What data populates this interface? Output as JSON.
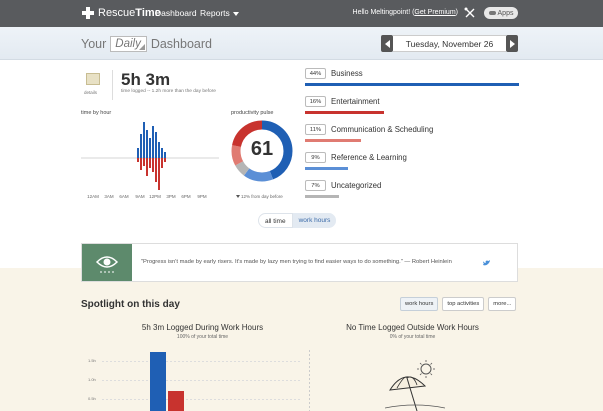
{
  "nav": {
    "logo_light": "Rescue",
    "logo_bold": "Time",
    "dashboard": "Dashboard",
    "reports": "Reports",
    "hello_prefix": "Hello Meltingpoint! (",
    "premium_link": "Get Premium",
    "hello_suffix": ")",
    "apps": "Apps"
  },
  "header": {
    "your": "Your",
    "period": "Daily",
    "dashboard": "Dashboard",
    "date": "Tuesday, November 26"
  },
  "summary": {
    "details_label": "details",
    "total_time": "5h 3m",
    "note": "time logged -- 1.2h more than the day before"
  },
  "hourly": {
    "label": "time by hour",
    "hours": [
      "12AM",
      "3AM",
      "6AM",
      "9AM",
      "12PM",
      "3PM",
      "6PM",
      "9PM"
    ]
  },
  "pulse": {
    "label": "productivity pulse",
    "value": "61",
    "note": "12% from day before"
  },
  "toggle": {
    "all_time": "all time",
    "work_hours": "work hours"
  },
  "categories": [
    {
      "pct": "44%",
      "name": "Business",
      "fraction": 1.0,
      "color": "#1f5fb4"
    },
    {
      "pct": "16%",
      "name": "Entertainment",
      "fraction": 0.37,
      "color": "#c8332e"
    },
    {
      "pct": "11%",
      "name": "Communication & Scheduling",
      "fraction": 0.26,
      "color": "#e07b72"
    },
    {
      "pct": "9%",
      "name": "Reference & Learning",
      "fraction": 0.2,
      "color": "#5b8fd6"
    },
    {
      "pct": "7%",
      "name": "Uncategorized",
      "fraction": 0.16,
      "color": "#b5b5b5"
    }
  ],
  "quote": {
    "text": "\"Progress isn't made by early risers. It's made by lazy men trying to find easier ways to do something.\" — Robert Heinlein"
  },
  "spotlight": {
    "title": "Spotlight on this day",
    "tabs": [
      "work hours",
      "top activities",
      "more..."
    ],
    "left_title": "5h 3m Logged During Work Hours",
    "left_sub": "100% of your total time",
    "right_title": "No Time Logged Outside Work Hours",
    "right_sub": "0% of your total time",
    "y_ticks": [
      "1.5h",
      "1.0h",
      "0.5h"
    ]
  },
  "colors": {
    "nav_bg": "#595b5e",
    "very_productive": "#1f5fb4",
    "very_distracting": "#c8332e",
    "quote_green": "#5d8a6c"
  }
}
